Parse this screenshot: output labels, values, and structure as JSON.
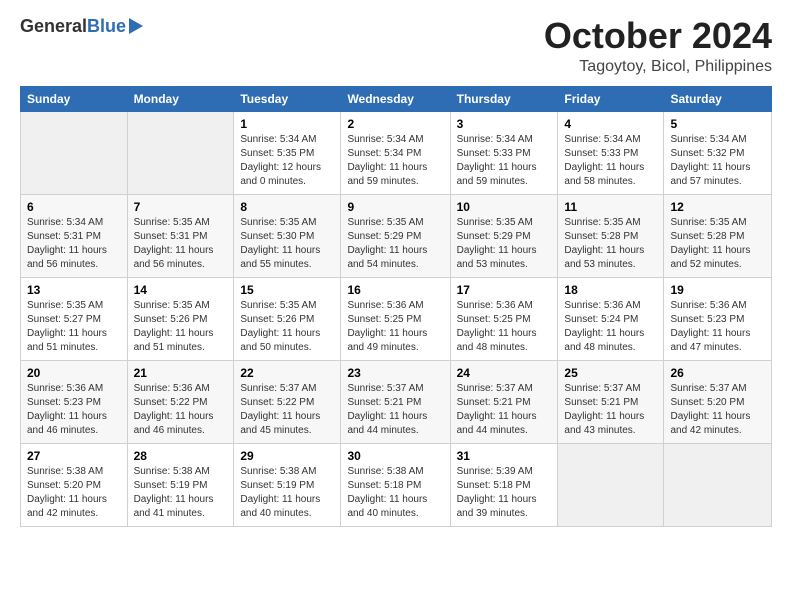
{
  "header": {
    "logo_general": "General",
    "logo_blue": "Blue",
    "month": "October 2024",
    "location": "Tagoytoy, Bicol, Philippines"
  },
  "columns": [
    "Sunday",
    "Monday",
    "Tuesday",
    "Wednesday",
    "Thursday",
    "Friday",
    "Saturday"
  ],
  "weeks": [
    [
      {
        "day": "",
        "detail": ""
      },
      {
        "day": "",
        "detail": ""
      },
      {
        "day": "1",
        "detail": "Sunrise: 5:34 AM\nSunset: 5:35 PM\nDaylight: 12 hours\nand 0 minutes."
      },
      {
        "day": "2",
        "detail": "Sunrise: 5:34 AM\nSunset: 5:34 PM\nDaylight: 11 hours\nand 59 minutes."
      },
      {
        "day": "3",
        "detail": "Sunrise: 5:34 AM\nSunset: 5:33 PM\nDaylight: 11 hours\nand 59 minutes."
      },
      {
        "day": "4",
        "detail": "Sunrise: 5:34 AM\nSunset: 5:33 PM\nDaylight: 11 hours\nand 58 minutes."
      },
      {
        "day": "5",
        "detail": "Sunrise: 5:34 AM\nSunset: 5:32 PM\nDaylight: 11 hours\nand 57 minutes."
      }
    ],
    [
      {
        "day": "6",
        "detail": "Sunrise: 5:34 AM\nSunset: 5:31 PM\nDaylight: 11 hours\nand 56 minutes."
      },
      {
        "day": "7",
        "detail": "Sunrise: 5:35 AM\nSunset: 5:31 PM\nDaylight: 11 hours\nand 56 minutes."
      },
      {
        "day": "8",
        "detail": "Sunrise: 5:35 AM\nSunset: 5:30 PM\nDaylight: 11 hours\nand 55 minutes."
      },
      {
        "day": "9",
        "detail": "Sunrise: 5:35 AM\nSunset: 5:29 PM\nDaylight: 11 hours\nand 54 minutes."
      },
      {
        "day": "10",
        "detail": "Sunrise: 5:35 AM\nSunset: 5:29 PM\nDaylight: 11 hours\nand 53 minutes."
      },
      {
        "day": "11",
        "detail": "Sunrise: 5:35 AM\nSunset: 5:28 PM\nDaylight: 11 hours\nand 53 minutes."
      },
      {
        "day": "12",
        "detail": "Sunrise: 5:35 AM\nSunset: 5:28 PM\nDaylight: 11 hours\nand 52 minutes."
      }
    ],
    [
      {
        "day": "13",
        "detail": "Sunrise: 5:35 AM\nSunset: 5:27 PM\nDaylight: 11 hours\nand 51 minutes."
      },
      {
        "day": "14",
        "detail": "Sunrise: 5:35 AM\nSunset: 5:26 PM\nDaylight: 11 hours\nand 51 minutes."
      },
      {
        "day": "15",
        "detail": "Sunrise: 5:35 AM\nSunset: 5:26 PM\nDaylight: 11 hours\nand 50 minutes."
      },
      {
        "day": "16",
        "detail": "Sunrise: 5:36 AM\nSunset: 5:25 PM\nDaylight: 11 hours\nand 49 minutes."
      },
      {
        "day": "17",
        "detail": "Sunrise: 5:36 AM\nSunset: 5:25 PM\nDaylight: 11 hours\nand 48 minutes."
      },
      {
        "day": "18",
        "detail": "Sunrise: 5:36 AM\nSunset: 5:24 PM\nDaylight: 11 hours\nand 48 minutes."
      },
      {
        "day": "19",
        "detail": "Sunrise: 5:36 AM\nSunset: 5:23 PM\nDaylight: 11 hours\nand 47 minutes."
      }
    ],
    [
      {
        "day": "20",
        "detail": "Sunrise: 5:36 AM\nSunset: 5:23 PM\nDaylight: 11 hours\nand 46 minutes."
      },
      {
        "day": "21",
        "detail": "Sunrise: 5:36 AM\nSunset: 5:22 PM\nDaylight: 11 hours\nand 46 minutes."
      },
      {
        "day": "22",
        "detail": "Sunrise: 5:37 AM\nSunset: 5:22 PM\nDaylight: 11 hours\nand 45 minutes."
      },
      {
        "day": "23",
        "detail": "Sunrise: 5:37 AM\nSunset: 5:21 PM\nDaylight: 11 hours\nand 44 minutes."
      },
      {
        "day": "24",
        "detail": "Sunrise: 5:37 AM\nSunset: 5:21 PM\nDaylight: 11 hours\nand 44 minutes."
      },
      {
        "day": "25",
        "detail": "Sunrise: 5:37 AM\nSunset: 5:21 PM\nDaylight: 11 hours\nand 43 minutes."
      },
      {
        "day": "26",
        "detail": "Sunrise: 5:37 AM\nSunset: 5:20 PM\nDaylight: 11 hours\nand 42 minutes."
      }
    ],
    [
      {
        "day": "27",
        "detail": "Sunrise: 5:38 AM\nSunset: 5:20 PM\nDaylight: 11 hours\nand 42 minutes."
      },
      {
        "day": "28",
        "detail": "Sunrise: 5:38 AM\nSunset: 5:19 PM\nDaylight: 11 hours\nand 41 minutes."
      },
      {
        "day": "29",
        "detail": "Sunrise: 5:38 AM\nSunset: 5:19 PM\nDaylight: 11 hours\nand 40 minutes."
      },
      {
        "day": "30",
        "detail": "Sunrise: 5:38 AM\nSunset: 5:18 PM\nDaylight: 11 hours\nand 40 minutes."
      },
      {
        "day": "31",
        "detail": "Sunrise: 5:39 AM\nSunset: 5:18 PM\nDaylight: 11 hours\nand 39 minutes."
      },
      {
        "day": "",
        "detail": ""
      },
      {
        "day": "",
        "detail": ""
      }
    ]
  ]
}
